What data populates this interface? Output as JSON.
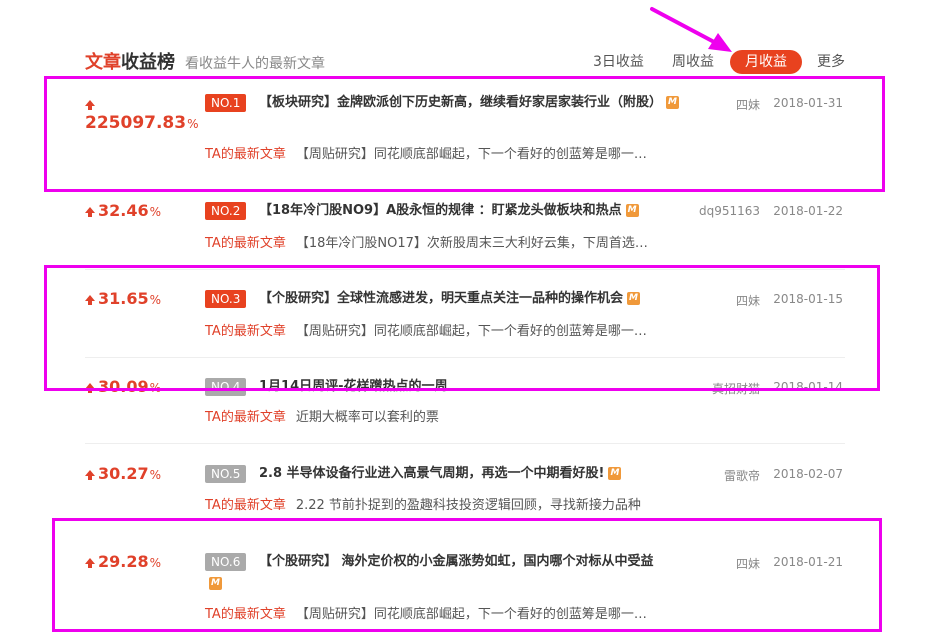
{
  "header": {
    "title_part1": "文章",
    "title_part2": "收益榜",
    "subtitle": "看收益牛人的最新文章",
    "tabs": [
      {
        "label": "3日收益",
        "active": false
      },
      {
        "label": "周收益",
        "active": false
      },
      {
        "label": "月收益",
        "active": true
      },
      {
        "label": "更多",
        "active": false
      }
    ]
  },
  "latest_label": "TA的最新文章",
  "badge_letter": "M",
  "rows": [
    {
      "gain": "225097.83",
      "pct": "%",
      "rank": "NO.1",
      "title": "【板块研究】金牌欧派创下历史新高，继续看好家居家装行业（附股）",
      "author": "四妹",
      "date": "2018-01-31",
      "latest": "【周贴研究】同花顺底部崛起，下一个看好的创蓝筹是哪一…"
    },
    {
      "gain": "32.46",
      "pct": "%",
      "rank": "NO.2",
      "title": "【18年冷门股NO9】A股永恒的规律 ：盯紧龙头做板块和热点",
      "author": "dq951163",
      "date": "2018-01-22",
      "latest": "【18年冷门股NO17】次新股周末三大利好云集，下周首选…"
    },
    {
      "gain": "31.65",
      "pct": "%",
      "rank": "NO.3",
      "title": "【个股研究】全球性流感进发，明天重点关注一品种的操作机会",
      "author": "四妹",
      "date": "2018-01-15",
      "latest": "【周贴研究】同花顺底部崛起，下一个看好的创蓝筹是哪一…"
    },
    {
      "gain": "30.09",
      "pct": "%",
      "rank": "NO.4",
      "title": "1月14日周评-花样蹭热点的一周",
      "author": "真招财猫",
      "date": "2018-01-14",
      "latest": "近期大概率可以套利的票"
    },
    {
      "gain": "30.27",
      "pct": "%",
      "rank": "NO.5",
      "title": "2.8 半导体设备行业进入高景气周期，再选一个中期看好股!",
      "author": "雷歌帝",
      "date": "2018-02-07",
      "latest": "2.22 节前扑捉到的盈趣科技投资逻辑回顾，寻找新接力品种"
    },
    {
      "gain": "29.28",
      "pct": "%",
      "rank": "NO.6",
      "title": "【个股研究】 海外定价权的小金属涨势如虹，国内哪个对标从中受益",
      "author": "四妹",
      "date": "2018-01-21",
      "latest": "【周贴研究】同花顺底部崛起，下一个看好的创蓝筹是哪一…"
    }
  ]
}
